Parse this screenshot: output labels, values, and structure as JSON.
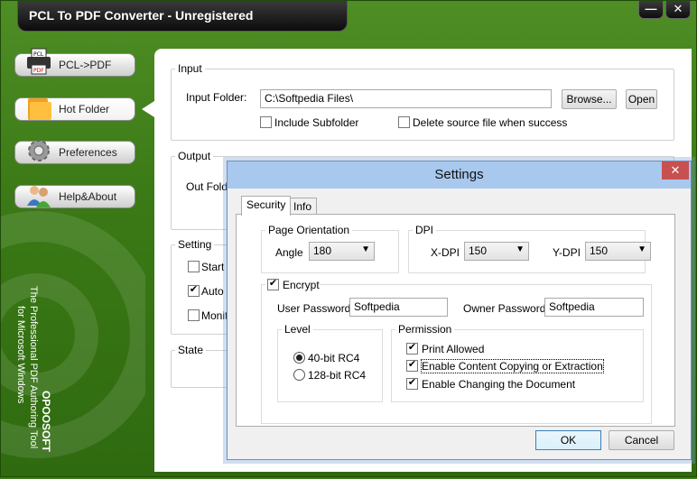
{
  "app": {
    "title": "PCL To PDF Converter - Unregistered",
    "minimize_symbol": "—",
    "close_symbol": "✕"
  },
  "nav": [
    {
      "label": "PCL->PDF",
      "icon": "printer-icon"
    },
    {
      "label": "Hot Folder",
      "icon": "folder-icon"
    },
    {
      "label": "Preferences",
      "icon": "gear-icon"
    },
    {
      "label": "Help&About",
      "icon": "users-icon"
    }
  ],
  "tagline": {
    "brand": "OPOOSOFT",
    "line1": "The Professional PDF Authoring Tool",
    "line2": "for Microsoft Windows"
  },
  "main": {
    "input": {
      "group_label": "Input",
      "folder_label": "Input Folder:",
      "folder_value": "C:\\Softpedia Files\\",
      "browse_label": "Browse...",
      "open_label": "Open",
      "include_subfolder": "Include Subfolder",
      "delete_source": "Delete source file when success"
    },
    "output": {
      "group_label": "Output",
      "folder_label_partial": "Out Folde"
    },
    "setting": {
      "group_label": "Setting",
      "start_partial": "Start w",
      "auto_partial": "Auto r",
      "monitor_partial": "Monito"
    },
    "state": {
      "group_label": "State"
    }
  },
  "dialog": {
    "title": "Settings",
    "close_symbol": "✕",
    "tabs": [
      {
        "label": "Security"
      },
      {
        "label": "Info"
      }
    ],
    "page_orientation": {
      "group_label": "Page Orientation",
      "angle_label": "Angle",
      "angle_value": "180"
    },
    "dpi": {
      "group_label": "DPI",
      "xdpi_label": "X-DPI",
      "xdpi_value": "150",
      "ydpi_label": "Y-DPI",
      "ydpi_value": "150"
    },
    "encrypt": {
      "label": "Encrypt",
      "user_password_label": "User Password",
      "user_password_value": "Softpedia",
      "owner_password_label": "Owner Password",
      "owner_password_value": "Softpedia"
    },
    "level": {
      "group_label": "Level",
      "option_40": "40-bit RC4",
      "option_128": "128-bit RC4"
    },
    "permission": {
      "group_label": "Permission",
      "print": "Print Allowed",
      "copy": "Enable Content Copying or Extraction",
      "change": "Enable Changing the Document"
    },
    "ok_label": "OK",
    "cancel_label": "Cancel"
  }
}
